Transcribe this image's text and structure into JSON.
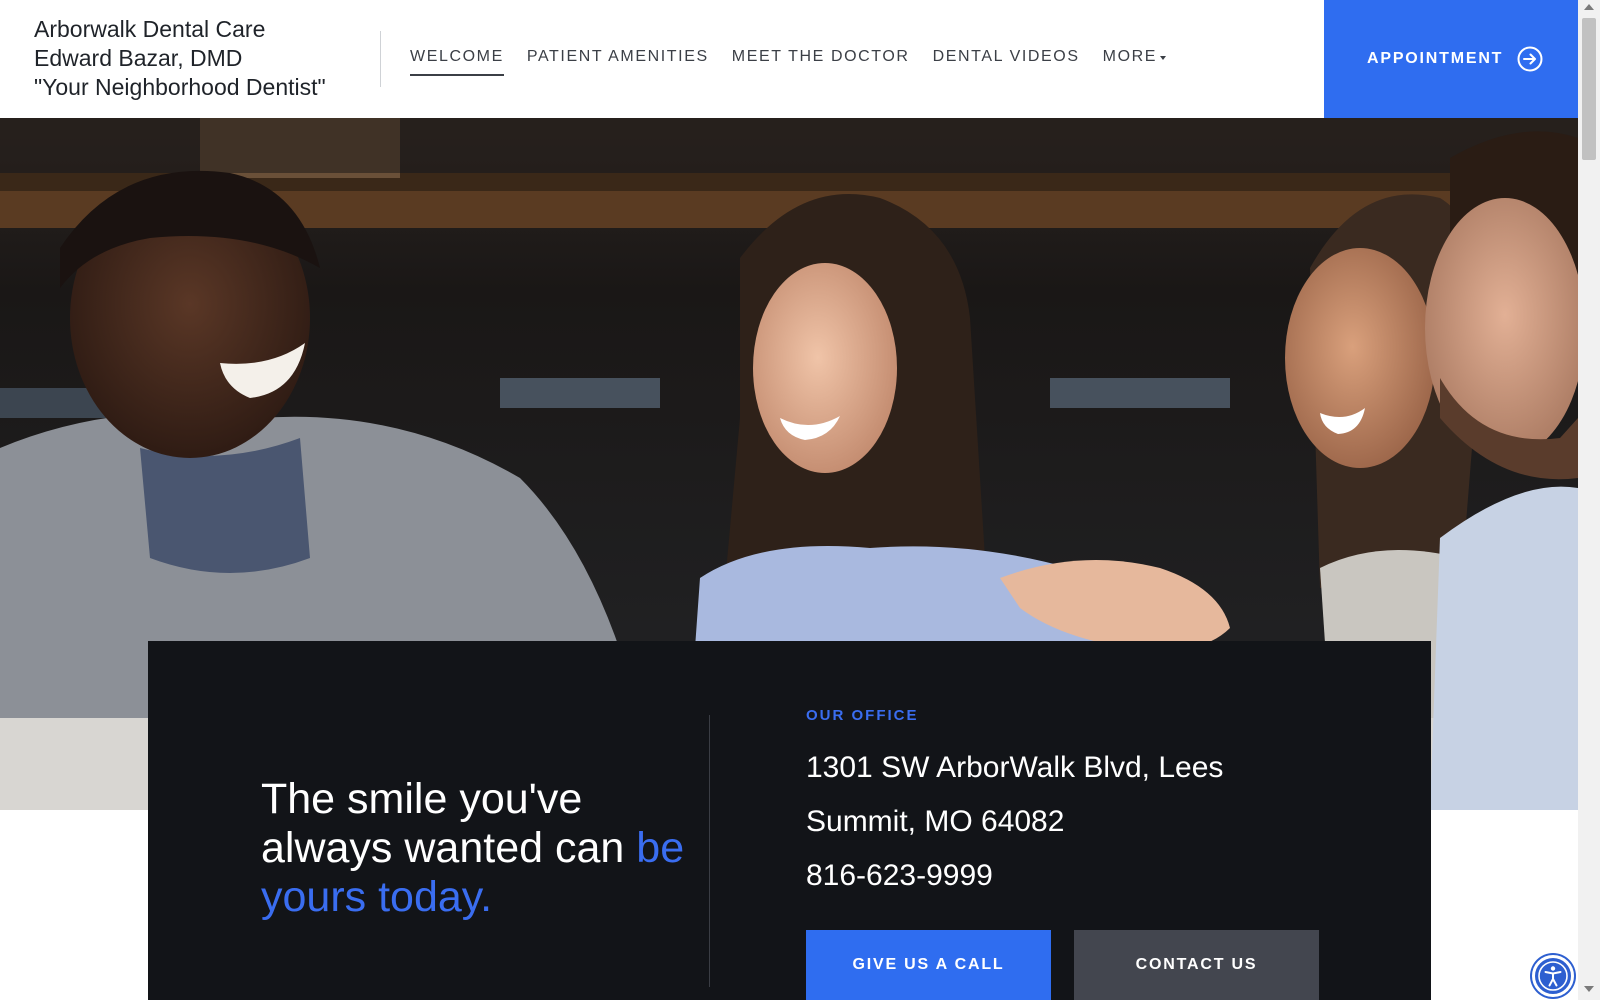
{
  "brand": {
    "line1": "Arborwalk Dental Care",
    "line2": "Edward Bazar, DMD",
    "line3": "\"Your Neighborhood Dentist\""
  },
  "nav": {
    "items": [
      {
        "label": "WELCOME",
        "active": true
      },
      {
        "label": "PATIENT AMENITIES",
        "active": false
      },
      {
        "label": "MEET THE DOCTOR",
        "active": false
      },
      {
        "label": "DENTAL VIDEOS",
        "active": false
      },
      {
        "label": "MORE",
        "active": false
      }
    ],
    "appointment_label": "APPOINTMENT"
  },
  "hero": {
    "tagline_part1": "The smile you've always wanted can",
    "tagline_accent": "be yours today."
  },
  "office": {
    "label": "OUR OFFICE",
    "address": "1301 SW ArborWalk Blvd, Lees Summit, MO 64082",
    "phone": "816-623-9999",
    "call_button": "GIVE US A CALL",
    "contact_button": "CONTACT US"
  },
  "colors": {
    "accent": "#2f6df0",
    "panel": "#121418",
    "secondary_button": "#43464f"
  },
  "icons": {
    "appointment": "arrow-circle-right-icon",
    "accessibility": "accessibility-icon",
    "more": "caret-down-icon"
  }
}
